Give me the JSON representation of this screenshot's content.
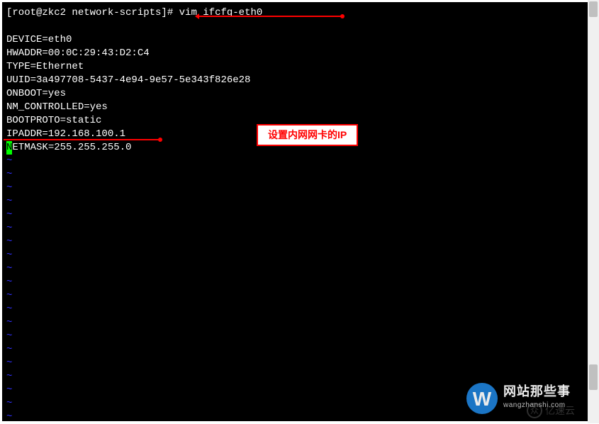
{
  "prompt": {
    "user_host": "[root@zkc2 network-scripts]#",
    "command": "vim ifcfg-eth0"
  },
  "config": {
    "device": "DEVICE=eth0",
    "hwaddr": "HWADDR=00:0C:29:43:D2:C4",
    "type": "TYPE=Ethernet",
    "uuid": "UUID=3a497708-5437-4e94-9e57-5e343f826e28",
    "onboot": "ONBOOT=yes",
    "nm_controlled": "NM_CONTROLLED=yes",
    "bootproto": "BOOTPROTO=static",
    "ipaddr": "IPADDR=192.168.100.1",
    "netmask_first": "N",
    "netmask_rest": "ETMASK=255.255.255.0"
  },
  "tilde": "~",
  "annotation": {
    "label": "设置内网网卡的IP"
  },
  "watermark": {
    "icon_letter": "W",
    "cn": "网站那些事",
    "en": "wangzhanshi.com"
  },
  "watermark2": {
    "symbol": "众",
    "text": "亿速云"
  }
}
